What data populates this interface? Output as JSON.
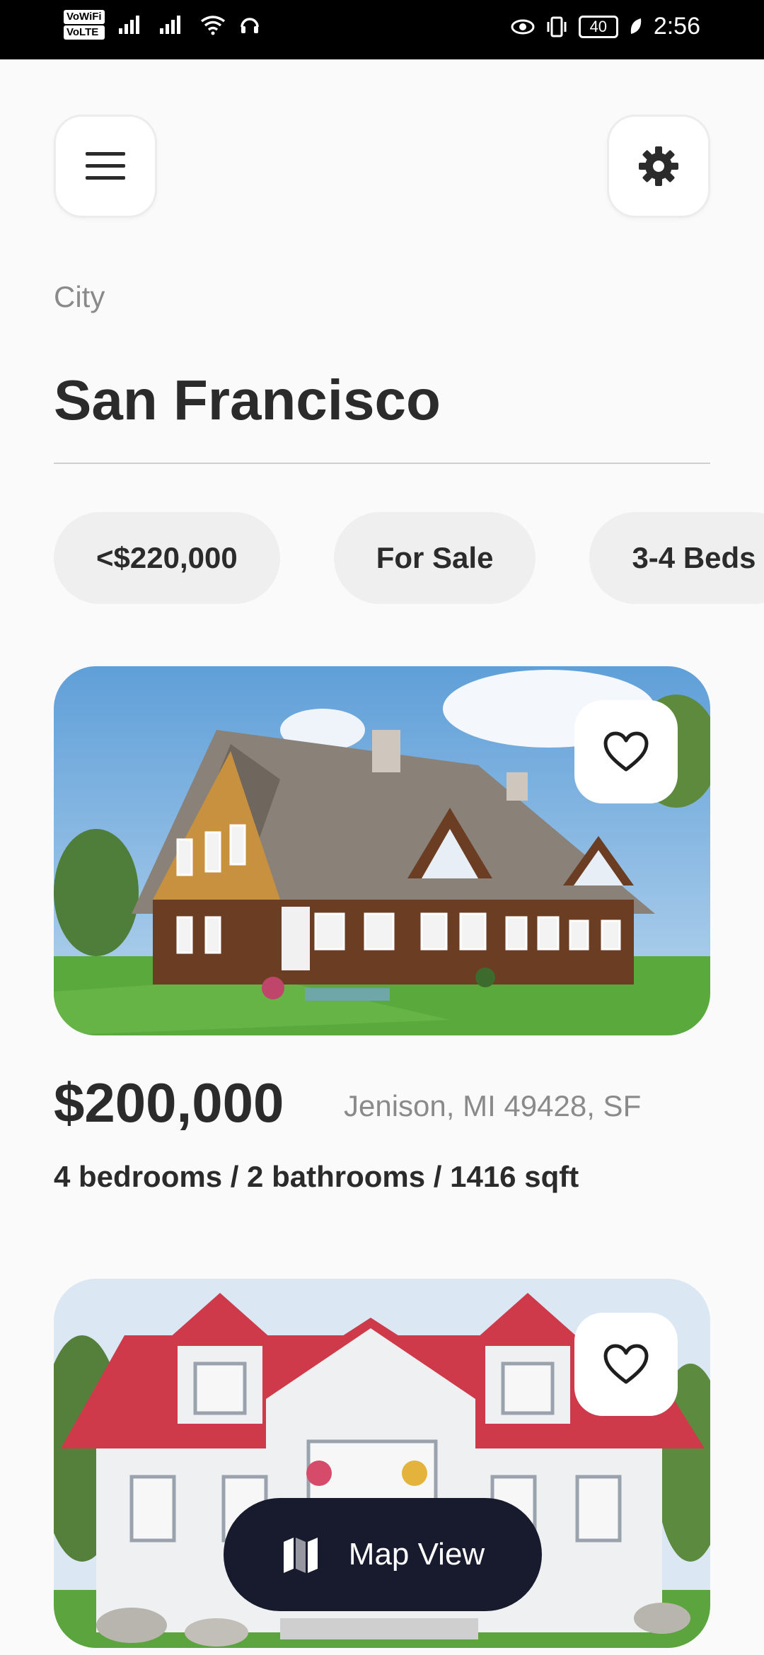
{
  "status_bar": {
    "net_top": "VoWiFi",
    "net_bottom": "VoLTE",
    "battery": "40",
    "time": "2:56"
  },
  "header": {
    "city_label": "City",
    "city_name": "San Francisco"
  },
  "filters": [
    "<$220,000",
    "For Sale",
    "3-4 Beds"
  ],
  "listings": [
    {
      "price": "$200,000",
      "address": "Jenison, MI 49428, SF",
      "details": "4 bedrooms / 2 bathrooms / 1416 sqft"
    }
  ],
  "map_button": {
    "label": "Map View"
  },
  "icons": {
    "menu": "menu-icon",
    "settings": "gear-icon",
    "favorite": "heart-icon",
    "map": "map-icon"
  },
  "colors": {
    "background": "#fafafa",
    "chip": "#efefef",
    "map_button": "#181a2e",
    "text_primary": "#2b2b2b",
    "text_secondary": "#8a8a8a"
  }
}
